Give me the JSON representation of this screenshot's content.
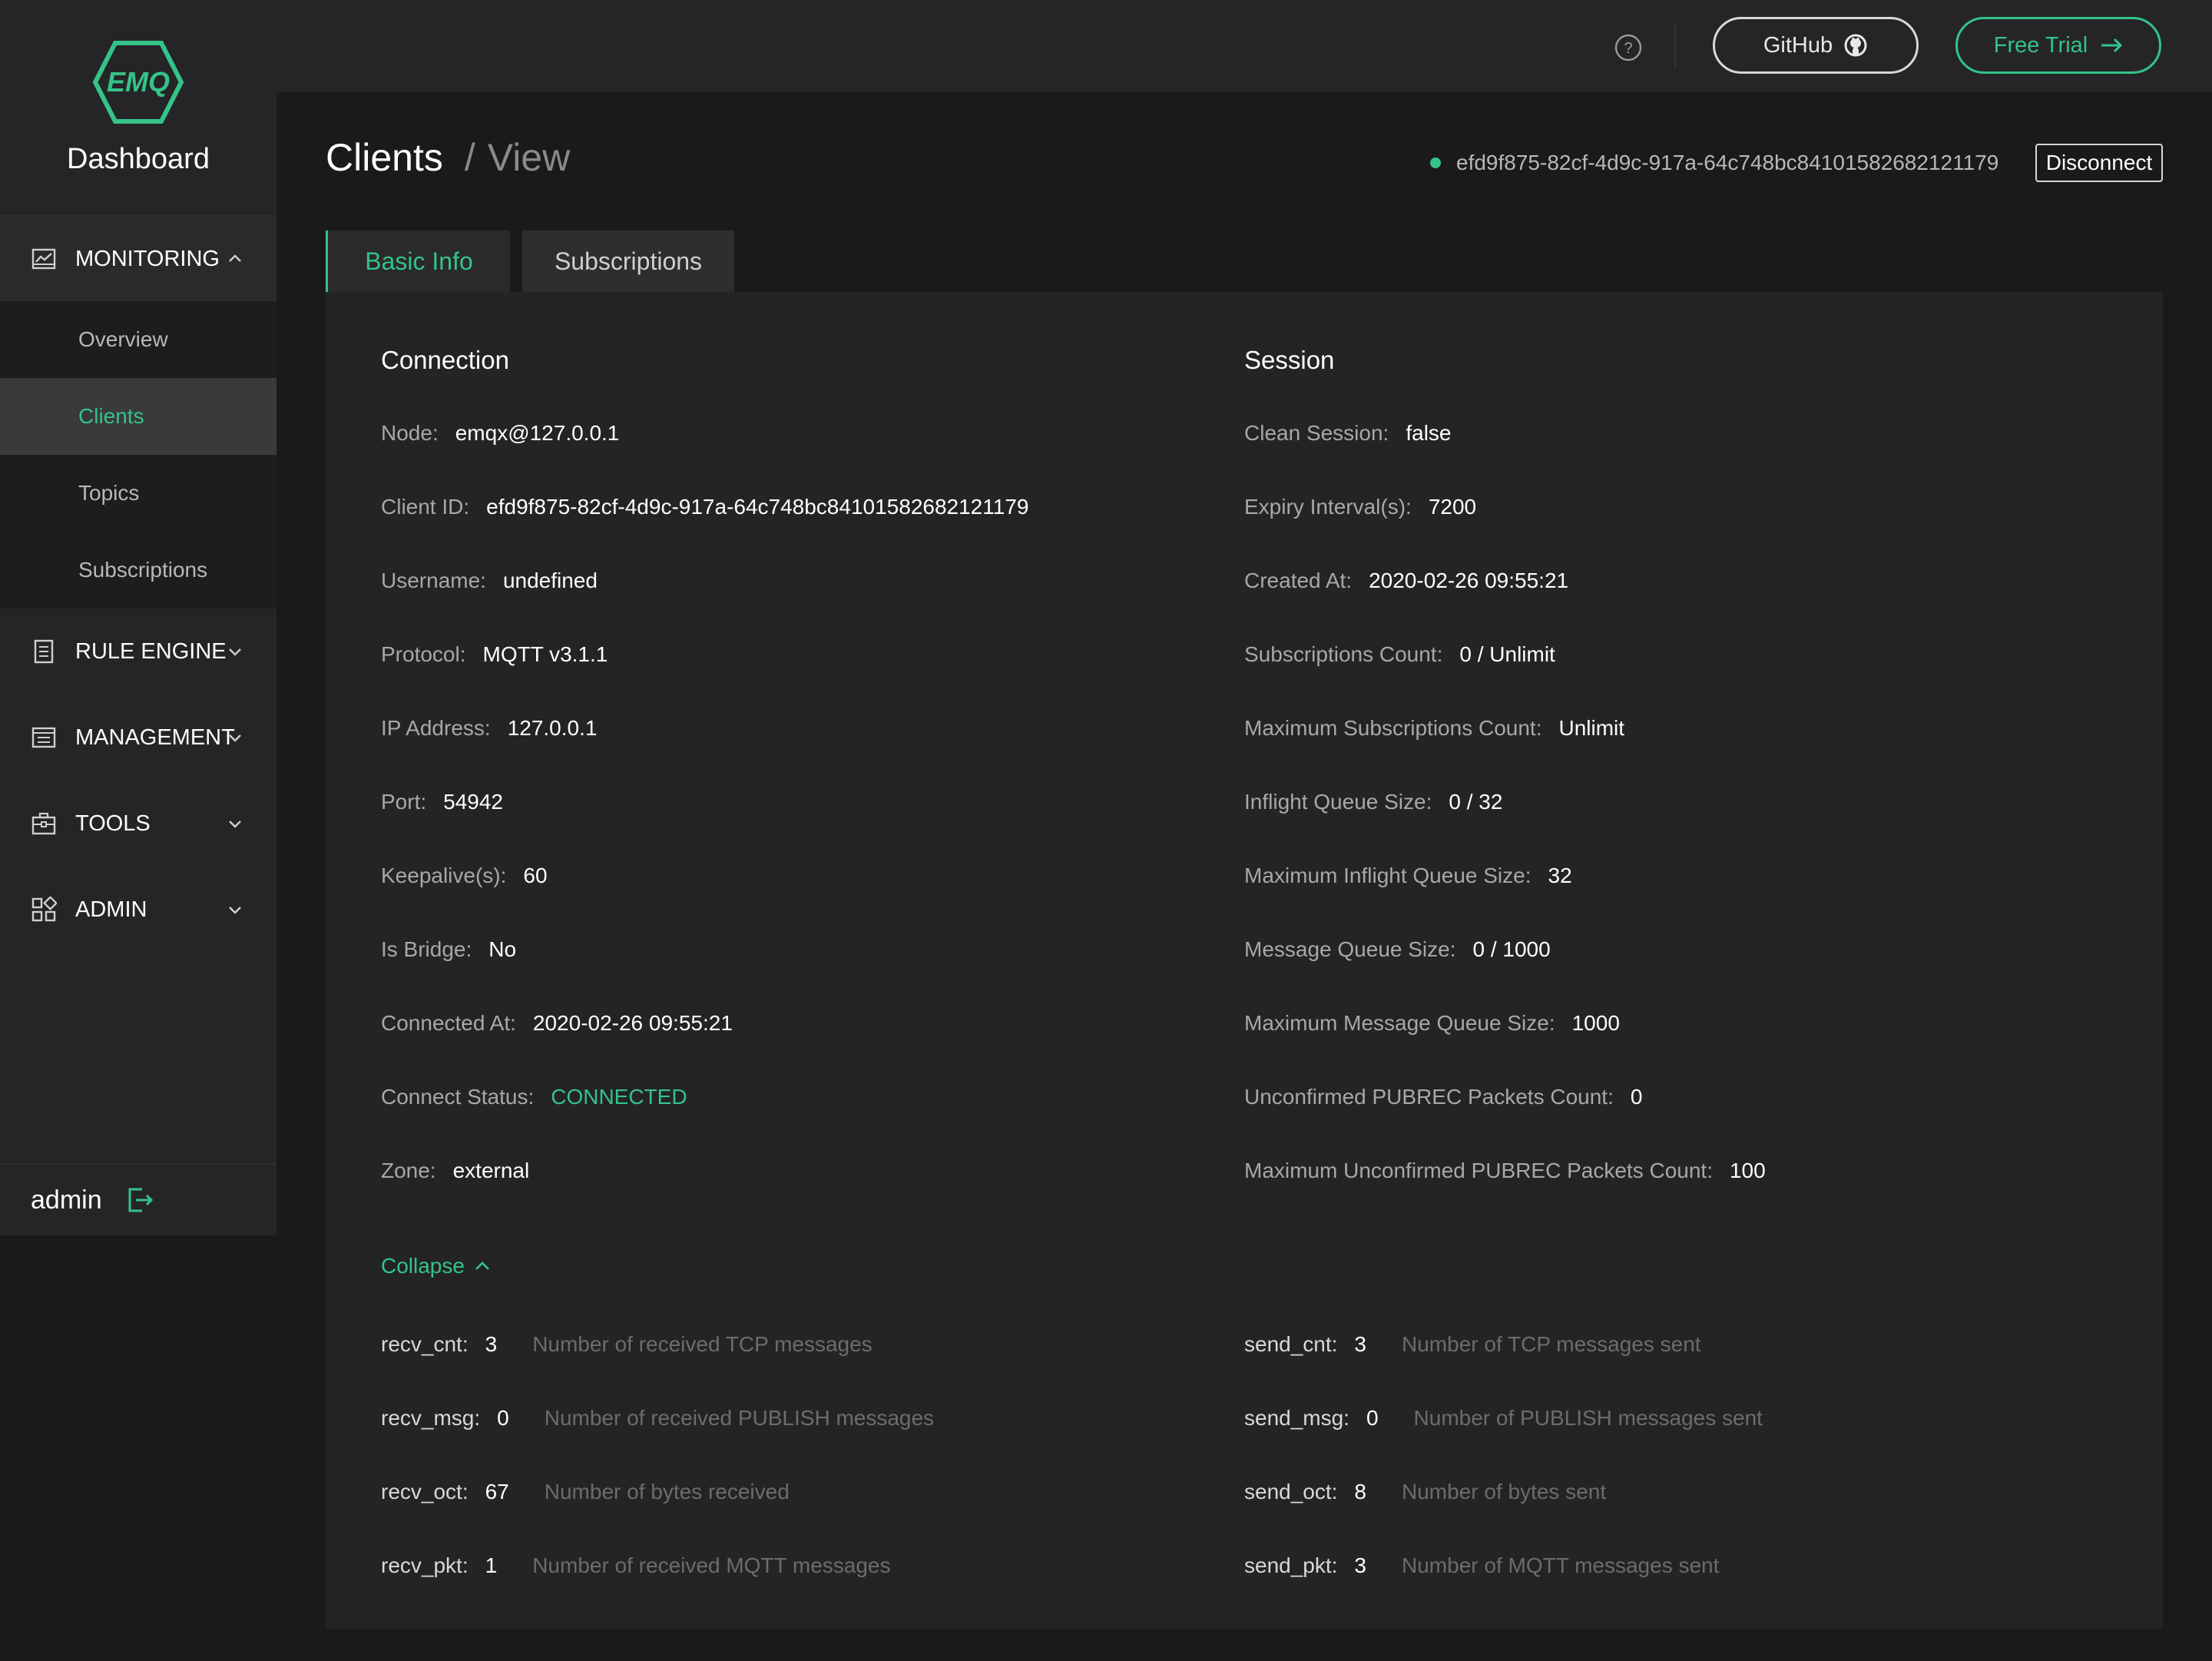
{
  "colors": {
    "accent": "#34c388",
    "background": "#1a1a1b",
    "panel": "#242426"
  },
  "sidebar": {
    "logo_text": "EMQ",
    "title": "Dashboard",
    "groups": [
      {
        "label": "MONITORING",
        "icon": "chart-icon",
        "expanded": true,
        "items": [
          {
            "label": "Overview"
          },
          {
            "label": "Clients",
            "active": true
          },
          {
            "label": "Topics"
          },
          {
            "label": "Subscriptions"
          }
        ]
      },
      {
        "label": "RULE ENGINE",
        "icon": "document-icon"
      },
      {
        "label": "MANAGEMENT",
        "icon": "list-icon"
      },
      {
        "label": "TOOLS",
        "icon": "toolbox-icon"
      },
      {
        "label": "ADMIN",
        "icon": "grid-icon"
      }
    ],
    "user": "admin"
  },
  "header": {
    "github_label": "GitHub",
    "trial_label": "Free Trial"
  },
  "breadcrumb": {
    "section": "Clients",
    "separator": "/",
    "page": "View"
  },
  "client": {
    "id": "efd9f875-82cf-4d9c-917a-64c748bc84101582682121179",
    "disconnect_label": "Disconnect"
  },
  "tabs": [
    {
      "label": "Basic Info",
      "active": true
    },
    {
      "label": "Subscriptions"
    }
  ],
  "connection": {
    "title": "Connection",
    "fields": [
      {
        "label": "Node:",
        "value": "emqx@127.0.0.1"
      },
      {
        "label": "Client ID:",
        "value": "efd9f875-82cf-4d9c-917a-64c748bc84101582682121179"
      },
      {
        "label": "Username:",
        "value": "undefined"
      },
      {
        "label": "Protocol:",
        "value": "MQTT v3.1.1"
      },
      {
        "label": "IP Address:",
        "value": "127.0.0.1"
      },
      {
        "label": "Port:",
        "value": "54942"
      },
      {
        "label": "Keepalive(s):",
        "value": "60"
      },
      {
        "label": "Is Bridge:",
        "value": "No"
      },
      {
        "label": "Connected At:",
        "value": "2020-02-26 09:55:21"
      },
      {
        "label": "Connect Status:",
        "value": "CONNECTED"
      },
      {
        "label": "Zone:",
        "value": "external"
      }
    ]
  },
  "session": {
    "title": "Session",
    "fields": [
      {
        "label": "Clean Session:",
        "value": "false"
      },
      {
        "label": "Expiry Interval(s):",
        "value": "7200"
      },
      {
        "label": "Created At:",
        "value": "2020-02-26 09:55:21"
      },
      {
        "label": "Subscriptions Count:",
        "value": "0 / Unlimit"
      },
      {
        "label": "Maximum Subscriptions Count:",
        "value": "Unlimit"
      },
      {
        "label": "Inflight Queue Size:",
        "value": "0 / 32"
      },
      {
        "label": "Maximum Inflight Queue Size:",
        "value": "32"
      },
      {
        "label": "Message Queue Size:",
        "value": "0 / 1000"
      },
      {
        "label": "Maximum Message Queue Size:",
        "value": "1000"
      },
      {
        "label": "Unconfirmed PUBREC Packets Count:",
        "value": "0"
      },
      {
        "label": "Maximum Unconfirmed PUBREC Packets Count:",
        "value": "100"
      }
    ]
  },
  "collapse_label": "Collapse",
  "metrics_recv": [
    {
      "key": "recv_cnt:",
      "value": "3",
      "desc": "Number of received TCP messages"
    },
    {
      "key": "recv_msg:",
      "value": "0",
      "desc": "Number of received PUBLISH messages"
    },
    {
      "key": "recv_oct:",
      "value": "67",
      "desc": "Number of bytes received"
    },
    {
      "key": "recv_pkt:",
      "value": "1",
      "desc": "Number of received MQTT messages"
    }
  ],
  "metrics_send": [
    {
      "key": "send_cnt:",
      "value": "3",
      "desc": "Number of TCP messages sent"
    },
    {
      "key": "send_msg:",
      "value": "0",
      "desc": "Number of PUBLISH messages sent"
    },
    {
      "key": "send_oct:",
      "value": "8",
      "desc": "Number of bytes sent"
    },
    {
      "key": "send_pkt:",
      "value": "3",
      "desc": "Number of MQTT messages sent"
    }
  ]
}
